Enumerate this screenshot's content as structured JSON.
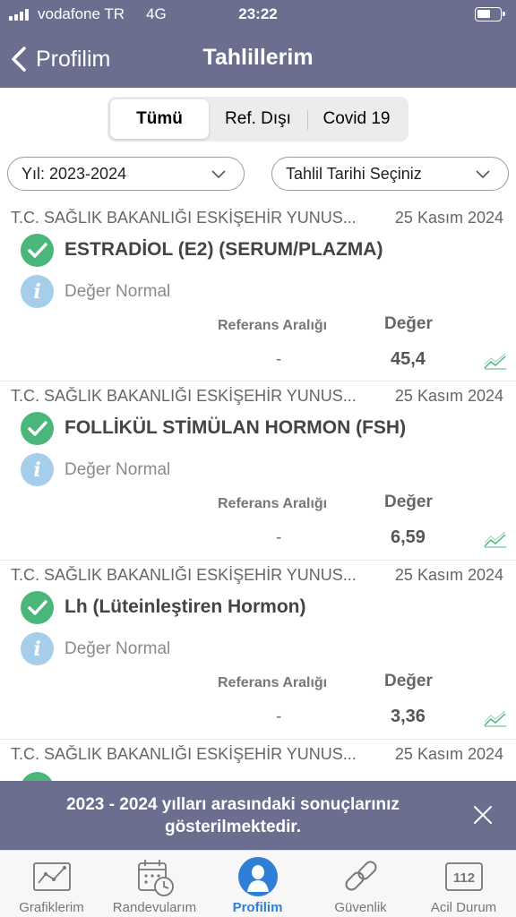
{
  "status_bar": {
    "carrier": "vodafone TR",
    "network": "4G",
    "time": "23:22"
  },
  "nav": {
    "back_label": "Profilim",
    "title": "Tahlillerim"
  },
  "segments": [
    "Tümü",
    "Ref. Dışı",
    "Covid 19"
  ],
  "segment_selected": "Tümü",
  "filters": {
    "year": "Yıl: 2023-2024",
    "date_placeholder": "Tahlil Tarihi Seçiniz"
  },
  "results": [
    {
      "institution": "T.C. SAĞLIK BAKANLIĞI ESKİŞEHİR YUNUS...",
      "date": "25 Kasım 2024",
      "test": "ESTRADİOL (E2) (SERUM/PLAZMA)",
      "status": "Değer Normal",
      "ref_header": "Referans Aralığı",
      "value_header": "Değer",
      "ref_range": "-",
      "value": "45,4"
    },
    {
      "institution": "T.C. SAĞLIK BAKANLIĞI ESKİŞEHİR YUNUS...",
      "date": "25 Kasım 2024",
      "test": "FOLLİKÜL STİMÜLAN HORMON (FSH)",
      "status": "Değer Normal",
      "ref_header": "Referans Aralığı",
      "value_header": "Değer",
      "ref_range": "-",
      "value": "6,59"
    },
    {
      "institution": "T.C. SAĞLIK BAKANLIĞI ESKİŞEHİR YUNUS...",
      "date": "25 Kasım 2024",
      "test": "Lh (Lüteinleştiren Hormon)",
      "status": "Değer Normal",
      "ref_header": "Referans Aralığı",
      "value_header": "Değer",
      "ref_range": "-",
      "value": "3,36"
    },
    {
      "institution": "T.C. SAĞLIK BAKANLIĞI ESKİŞEHİR YUNUS...",
      "date": "25 Kasım 2024"
    }
  ],
  "banner": {
    "text": "2023 - 2024 yılları arasındaki sonuçlarınız gösterilmektedir."
  },
  "tabs": [
    {
      "label": "Grafiklerim",
      "icon": "chart-icon"
    },
    {
      "label": "Randevularım",
      "icon": "calendar-clock-icon"
    },
    {
      "label": "Profilim",
      "icon": "profile-icon"
    },
    {
      "label": "Güvenlik",
      "icon": "chain-link-icon"
    },
    {
      "label": "Acil Durum",
      "icon": "emergency-112-icon"
    }
  ],
  "active_tab": "Profilim",
  "icon_badge_112": "112",
  "colors": {
    "header": "#6b6e8f",
    "check": "#4bb67a",
    "info": "#a6cdea",
    "active_tab": "#2f7fd6",
    "trend": "#4bb67a"
  }
}
